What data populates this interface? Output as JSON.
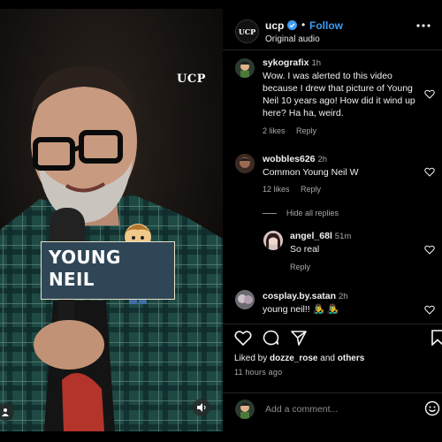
{
  "video": {
    "watermark": "UCP",
    "caption_line1": "YOUNG",
    "caption_line2": "NEIL"
  },
  "header": {
    "username": "ucp",
    "follow_label": "Follow",
    "dot": "•",
    "subtitle": "Original audio",
    "avatar_text": "UCP"
  },
  "comments": [
    {
      "username": "sykografix",
      "time": "1h",
      "text": "Wow. I was alerted to this video because I drew that picture of Young Neil 10 years ago! How did it wind up here? Ha ha, weird.",
      "likes": "2 likes",
      "reply": "Reply"
    },
    {
      "username": "wobbles626",
      "time": "2h",
      "text": "Common Young Neil W",
      "likes": "12 likes",
      "reply": "Reply",
      "hide_replies": "Hide all replies"
    },
    {
      "username": "angel_68l",
      "time": "51m",
      "text": "So real",
      "reply": "Reply"
    },
    {
      "username": "cosplay.by.satan",
      "time": "2h",
      "text": "young neil!! 👨‍🎤 👨‍🎤"
    }
  ],
  "footer": {
    "liked_prefix": "Liked by",
    "liked_user": "dozze_rose",
    "liked_and": "and",
    "liked_others": "others",
    "time": "11 hours ago",
    "add_comment_placeholder": "Add a comment..."
  },
  "colors": {
    "accent": "#3b9cf5",
    "background": "#000000",
    "muted": "#a8a8a8",
    "caption_bg": "#2f4656"
  }
}
